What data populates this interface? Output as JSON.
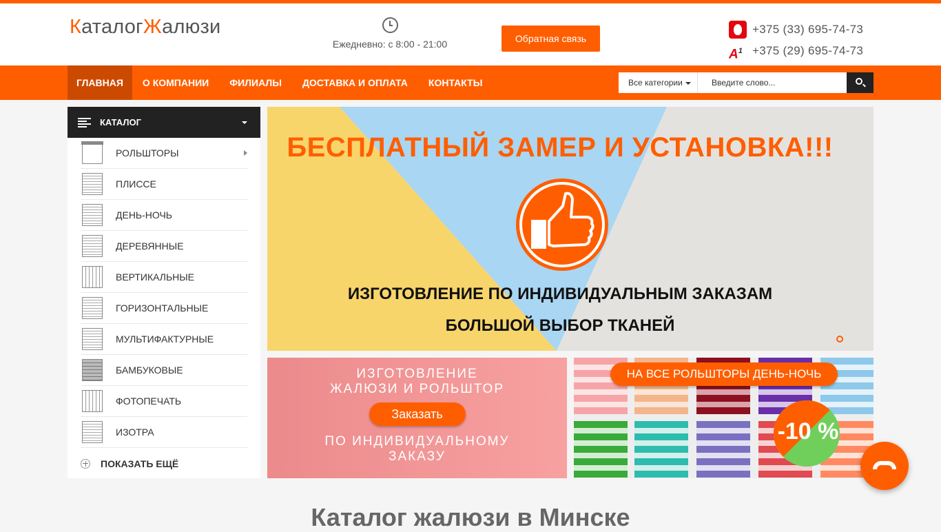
{
  "header": {
    "logo_k": "К",
    "logo_atalog": "аталог",
    "logo_zh": "Ж",
    "logo_alyuzi": "алюзи",
    "hours": "Ежедневно: с 8:00 - 21:00",
    "callback_label": "Обратная связь",
    "phones": [
      {
        "operator": "mts-icon",
        "number": "+375 (33) 695-74-73"
      },
      {
        "operator": "a1-icon",
        "number": "+375 (29) 695-74-73"
      }
    ],
    "a1_letter": "A",
    "a1_sup": "1"
  },
  "nav": {
    "items": [
      {
        "label": "ГЛАВНАЯ",
        "active": true
      },
      {
        "label": "О КОМПАНИИ"
      },
      {
        "label": "ФИЛИАЛЫ"
      },
      {
        "label": "ДОСТАВКА И ОПЛАТА"
      },
      {
        "label": "КОНТАКТЫ"
      }
    ]
  },
  "search": {
    "category": "Все категории",
    "placeholder": "Введите слово..."
  },
  "catalog": {
    "title": "КАТАЛОГ",
    "items": [
      {
        "label": "РОЛЬШТОРЫ",
        "has_sub": true
      },
      {
        "label": "ПЛИССЕ"
      },
      {
        "label": "ДЕНЬ-НОЧЬ"
      },
      {
        "label": "ДЕРЕВЯННЫЕ"
      },
      {
        "label": "ВЕРТИКАЛЬНЫЕ"
      },
      {
        "label": "ГОРИЗОНТАЛЬНЫЕ"
      },
      {
        "label": "МУЛЬТИФАКТУРНЫЕ"
      },
      {
        "label": "БАМБУКОВЫЕ"
      },
      {
        "label": "ФОТОПЕЧАТЬ"
      },
      {
        "label": "ИЗОТРА"
      }
    ],
    "show_more": "ПОКАЗАТЬ ЕЩЁ"
  },
  "hero": {
    "title": "БЕСПЛАТНЫЙ ЗАМЕР И УСТАНОВКА!!!",
    "line1": "ИЗГОТОВЛЕНИЕ ПО ИНДИВИДУАЛЬНЫМ ЗАКАЗАМ",
    "line2": "БОЛЬШОЙ ВЫБОР ТКАНЕЙ",
    "colors": {
      "yellow": "#f8d56b",
      "blue": "#a9d6f2",
      "gray": "#e4e2df",
      "accent": "#ff5e00"
    }
  },
  "banner_order": {
    "top_line1": "ИЗГОТОВЛЕНИЕ",
    "top_line2": "ЖАЛЮЗИ И РОЛЬШТОР",
    "button": "Заказать",
    "bot_line1": "ПО ИНДИВИДУАЛЬНОМУ",
    "bot_line2": "ЗАКАЗУ"
  },
  "banner_sale": {
    "label": "НА ВСЕ РОЛЬШТОРЫ ДЕНЬ-НОЧЬ",
    "discount": "-10 %"
  },
  "page_heading": "Каталог жалюзи в Минске",
  "theme": {
    "accent": "#ff5e00",
    "accent_dark": "#cc4a00",
    "dark": "#222222"
  }
}
